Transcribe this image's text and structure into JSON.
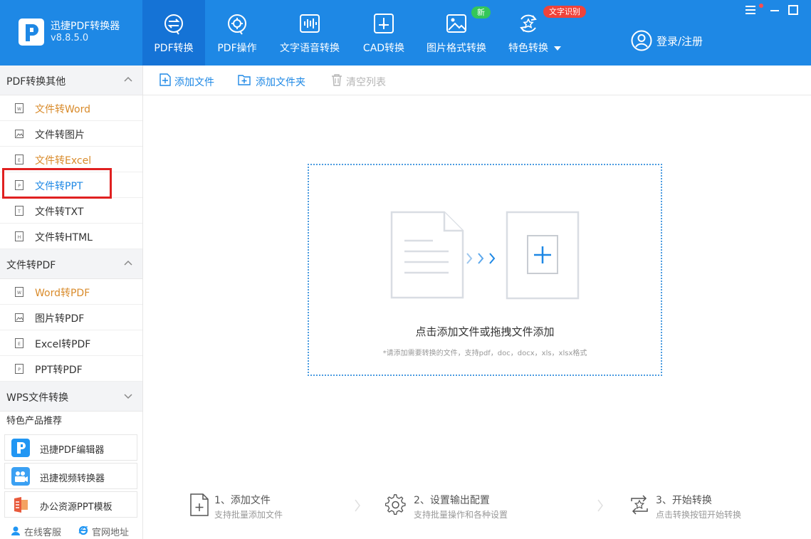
{
  "app": {
    "name": "迅捷PDF转换器",
    "version": "v8.8.5.0",
    "logo": "pdf-app-logo"
  },
  "nav": {
    "tabs": [
      {
        "label": "PDF转换",
        "icon": "convert-circle-icon",
        "active": true
      },
      {
        "label": "PDF操作",
        "icon": "gear-circle-icon",
        "active": false
      },
      {
        "label": "文字语音转换",
        "icon": "sound-wave-icon",
        "active": false
      },
      {
        "label": "CAD转换",
        "icon": "cad-icon",
        "active": false
      },
      {
        "label": "图片格式转换",
        "icon": "image-icon",
        "active": false,
        "badge": "新"
      },
      {
        "label": "特色转换",
        "icon": "star-refresh-icon",
        "active": false,
        "badge": "文字识别",
        "has_dropdown": true
      }
    ],
    "login_label": "登录/注册"
  },
  "sidebar": {
    "sections": [
      {
        "title": "PDF转换其他",
        "expanded": true,
        "items": [
          {
            "label": "文件转Word",
            "icon": "word-doc-icon",
            "style": "orange"
          },
          {
            "label": "文件转图片",
            "icon": "image-doc-icon",
            "style": "normal"
          },
          {
            "label": "文件转Excel",
            "icon": "excel-doc-icon",
            "style": "orange"
          },
          {
            "label": "文件转PPT",
            "icon": "ppt-doc-icon",
            "style": "selected"
          },
          {
            "label": "文件转TXT",
            "icon": "txt-doc-icon",
            "style": "normal"
          },
          {
            "label": "文件转HTML",
            "icon": "html-doc-icon",
            "style": "normal"
          }
        ]
      },
      {
        "title": "文件转PDF",
        "expanded": true,
        "items": [
          {
            "label": "Word转PDF",
            "icon": "word-doc-icon",
            "style": "orange"
          },
          {
            "label": "图片转PDF",
            "icon": "image-doc-icon",
            "style": "normal"
          },
          {
            "label": "Excel转PDF",
            "icon": "excel-doc-icon",
            "style": "normal"
          },
          {
            "label": "PPT转PDF",
            "icon": "ppt-doc-icon",
            "style": "normal"
          }
        ]
      },
      {
        "title": "WPS文件转换",
        "expanded": false,
        "items": []
      }
    ],
    "recommend_title": "特色产品推荐",
    "recommend": [
      {
        "label": "迅捷PDF编辑器",
        "icon": "pdf-editor-icon"
      },
      {
        "label": "迅捷视频转换器",
        "icon": "video-converter-icon"
      },
      {
        "label": "办公资源PPT模板",
        "icon": "ppt-template-icon"
      }
    ],
    "footer": [
      {
        "label": "在线客服",
        "icon": "support-icon"
      },
      {
        "label": "官网地址",
        "icon": "ie-browser-icon"
      }
    ]
  },
  "toolbar": {
    "add_file": "添加文件",
    "add_folder": "添加文件夹",
    "clear_list": "清空列表"
  },
  "dropzone": {
    "main_text": "点击添加文件或拖拽文件添加",
    "sub_text": "*请添加需要转换的文件，支持pdf，doc，docx，xls，xlsx格式"
  },
  "steps": [
    {
      "title": "1、添加文件",
      "desc": "支持批量添加文件",
      "icon": "add-file-icon"
    },
    {
      "title": "2、设置输出配置",
      "desc": "支持批量操作和各种设置",
      "icon": "settings-gear-icon"
    },
    {
      "title": "3、开始转换",
      "desc": "点击转换按钮开始转换",
      "icon": "start-convert-icon"
    }
  ],
  "colors": {
    "brand": "#1e88e5",
    "brand_dark": "#1573d6",
    "accent_orange": "#d98b2b",
    "highlight_red": "#e02020"
  }
}
